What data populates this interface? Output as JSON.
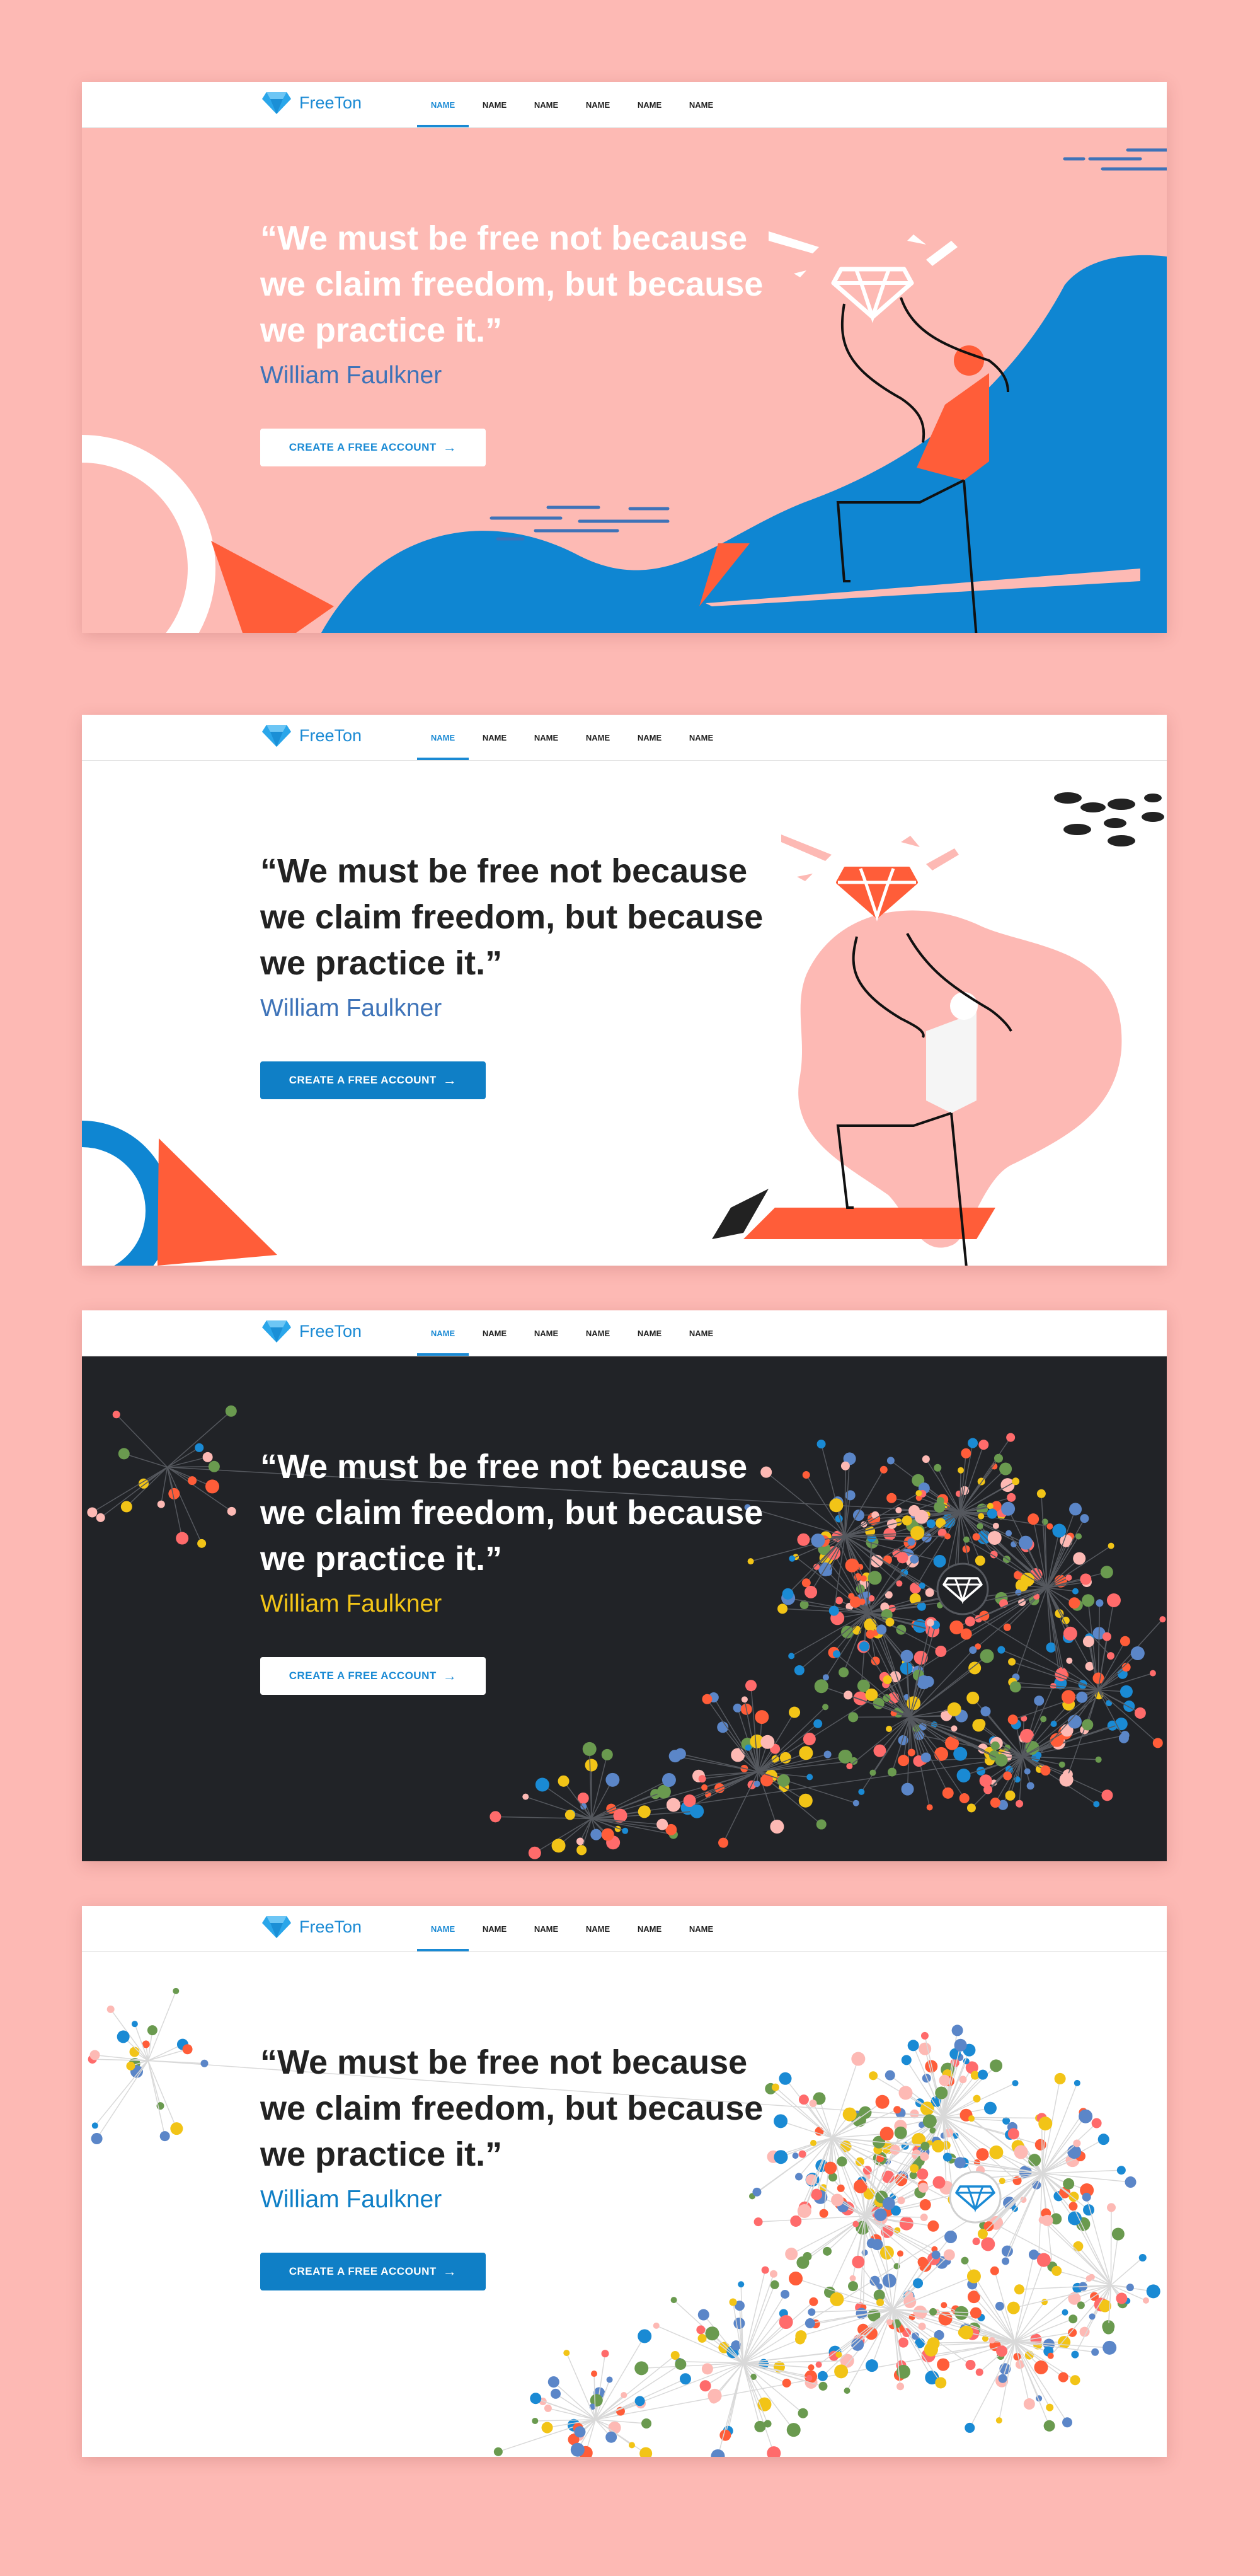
{
  "brand": {
    "name": "FreeTon"
  },
  "nav": [
    {
      "label": "NAME"
    },
    {
      "label": "NAME"
    },
    {
      "label": "NAME"
    },
    {
      "label": "NAME"
    },
    {
      "label": "NAME"
    },
    {
      "label": "NAME"
    }
  ],
  "hero": {
    "quote": "“We must be free not because we claim freedom, but because we practice it.”",
    "author": "William Faulkner",
    "cta_label": "CREATE A FREE ACCOUNT",
    "cta_icon": "arrow-right-icon"
  },
  "variants": [
    {
      "theme": "pink-illustration",
      "background": "#fdbab4",
      "quote_color": "#ffffff",
      "author_color": "#3e73b8",
      "cta_bg": "#ffffff",
      "cta_text": "#1a8ad4"
    },
    {
      "theme": "white-illustration",
      "background": "#ffffff",
      "quote_color": "#222222",
      "author_color": "#3e73b8",
      "cta_bg": "#0f7fc6",
      "cta_text": "#ffffff"
    },
    {
      "theme": "dark-network",
      "background": "#212327",
      "quote_color": "#ffffff",
      "author_color": "#f2c417",
      "cta_bg": "#ffffff",
      "cta_text": "#1a8ad4"
    },
    {
      "theme": "white-network",
      "background": "#ffffff",
      "quote_color": "#222222",
      "author_color": "#0f7fc6",
      "cta_bg": "#0f7fc6",
      "cta_text": "#ffffff"
    }
  ],
  "colors": {
    "page_bg": "#fdb9b4",
    "accent_blue": "#1a8ad4",
    "accent_orange": "#ff5d39"
  }
}
